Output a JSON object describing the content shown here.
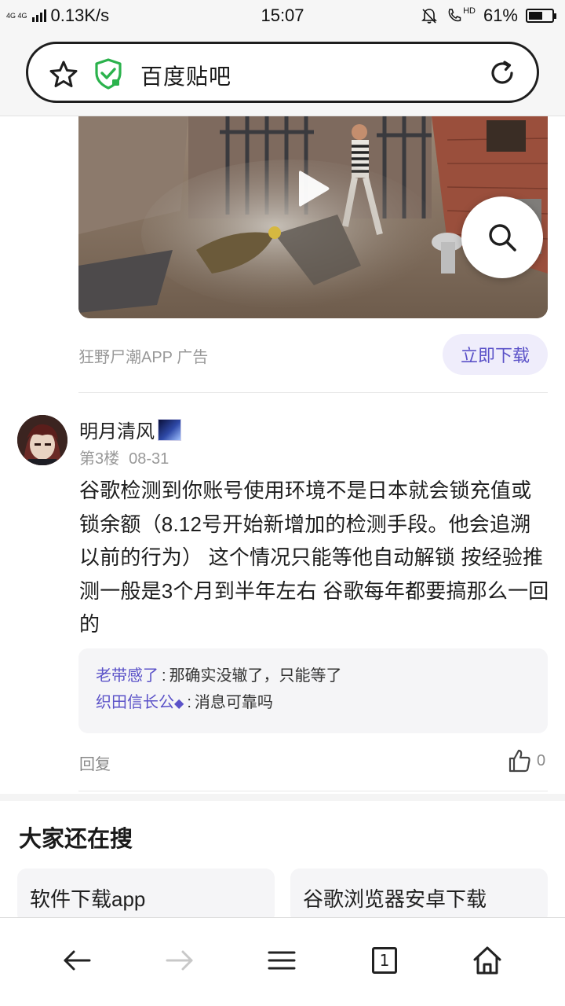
{
  "status_bar": {
    "network_type": "4G 4G",
    "speed": "0.13K/s",
    "time": "15:07",
    "hd_label": "HD",
    "battery": "61%",
    "battery_level": 0.61
  },
  "address_bar": {
    "title": "百度贴吧",
    "star_icon": "star-icon",
    "shield_icon": "shield-check-icon",
    "reload_icon": "reload-icon"
  },
  "ad": {
    "source": "狂野尸潮APP 广告",
    "download_label": "立即下载",
    "play_icon": "play-icon",
    "search_icon": "search-icon"
  },
  "post": {
    "author": "明月清风",
    "floor": "第3楼",
    "date": "08-31",
    "body": "谷歌检测到你账号使用环境不是日本就会锁充值或锁余额（8.12号开始新增加的检测手段。他会追溯以前的行为） 这个情况只能等他自动解锁 按经验推测一般是3个月到半年左右 谷歌每年都要搞那么一回的",
    "replies": [
      {
        "name": "老带感了",
        "separator": ":",
        "text": "那确实没辙了，只能等了"
      },
      {
        "name": "织田信长公",
        "separator": ":",
        "text": "消息可靠吗"
      }
    ],
    "reply_label": "回复",
    "like_count": "0"
  },
  "related_search": {
    "title": "大家还在搜",
    "items": [
      "软件下载app",
      "谷歌浏览器安卓下载"
    ]
  },
  "bottom_nav": {
    "tab_count": "1",
    "icons": [
      "back-arrow-icon",
      "forward-arrow-icon",
      "menu-icon",
      "tabs-icon",
      "home-icon"
    ]
  },
  "colors": {
    "accent": "#5b52c8",
    "shield_green": "#2bb24c",
    "muted_text": "#999999"
  }
}
